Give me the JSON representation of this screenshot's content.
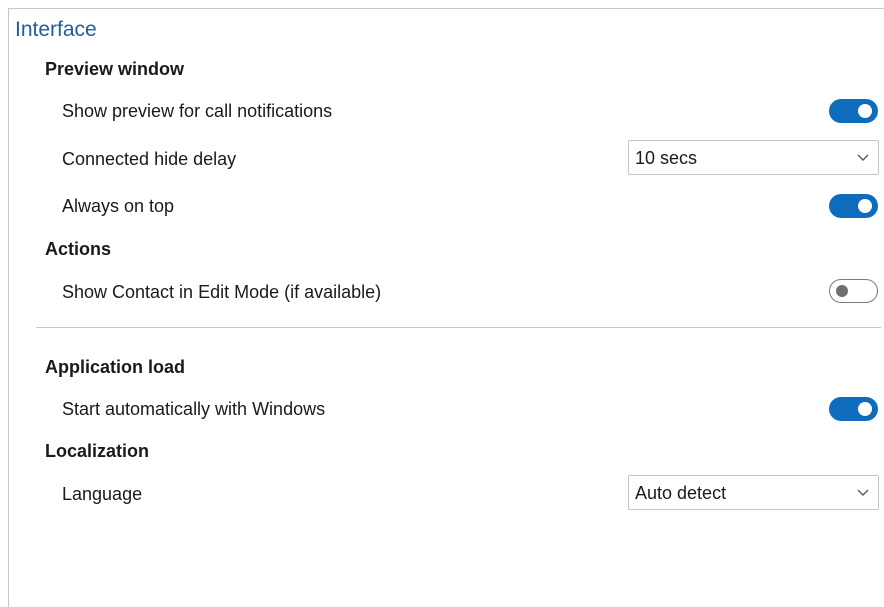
{
  "panel": {
    "title": "Interface"
  },
  "preview_window": {
    "heading": "Preview window",
    "show_preview": {
      "label": "Show preview for call notifications",
      "enabled": true
    },
    "hide_delay": {
      "label": "Connected hide delay",
      "value": "10 secs"
    },
    "always_on_top": {
      "label": "Always on top",
      "enabled": true
    }
  },
  "actions": {
    "heading": "Actions",
    "edit_mode": {
      "label": "Show Contact in Edit Mode (if available)",
      "enabled": false
    }
  },
  "application_load": {
    "heading": "Application load",
    "start_auto": {
      "label": "Start automatically with Windows",
      "enabled": true
    }
  },
  "localization": {
    "heading": "Localization",
    "language": {
      "label": "Language",
      "value": "Auto detect"
    }
  },
  "colors": {
    "accent": "#0f6cbd",
    "title": "#1f5f9e",
    "divider": "#c8c8c8"
  }
}
